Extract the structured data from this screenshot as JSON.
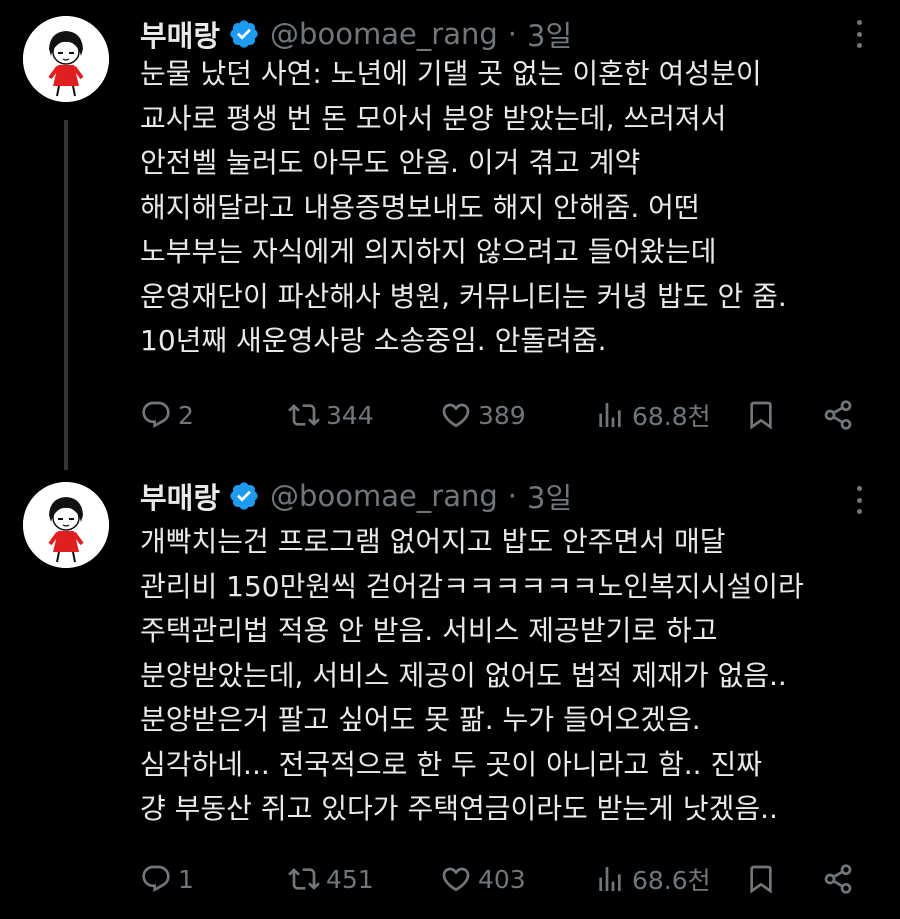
{
  "tweets": [
    {
      "name": "부매랑",
      "handle": "@boomae_rang",
      "separator": "·",
      "time": "3일",
      "text": "눈물 났던 사연: 노년에 기댈 곳 없는 이혼한 여성분이\n교사로 평생 번 돈 모아서 분양 받았는데, 쓰러져서\n안전벨 눌러도 아무도 안옴. 이거 겪고 계약\n해지해달라고 내용증명보내도 해지 안해줌. 어떤\n노부부는 자식에게 의지하지 않으려고 들어왔는데\n운영재단이 파산해사 병원, 커뮤니티는 커녕 밥도 안 줌.\n10년째 새운영사랑 소송중임. 안돌려줌.",
      "replies": "2",
      "retweets": "344",
      "likes": "389",
      "views": "68.8천"
    },
    {
      "name": "부매랑",
      "handle": "@boomae_rang",
      "separator": "·",
      "time": "3일",
      "text": "개빡치는건 프로그램 없어지고 밥도 안주면서 매달\n관리비 150만원씩 걷어감ㅋㅋㅋㅋㅋㅋ노인복지시설이라\n주택관리법 적용 안 받음. 서비스 제공받기로 하고\n분양받았는데, 서비스 제공이 없어도 법적 제재가 없음..\n분양받은거 팔고 싶어도 못 팖. 누가 들어오겠음.\n심각하네... 전국적으로 한 두 곳이 아니라고 함..  진짜\n걍 부동산 쥐고 있다가 주택연금이라도 받는게 낫겠음..",
      "replies": "1",
      "retweets": "451",
      "likes": "403",
      "views": "68.6천"
    }
  ],
  "colors": {
    "background": "#000000",
    "text": "#e7e9ea",
    "secondary": "#71767b",
    "verified": "#1d9bf0",
    "thread_line": "#333639"
  },
  "icons": [
    "verified-badge-icon",
    "more-icon",
    "reply-icon",
    "retweet-icon",
    "like-icon",
    "views-icon",
    "bookmark-icon",
    "share-icon"
  ]
}
